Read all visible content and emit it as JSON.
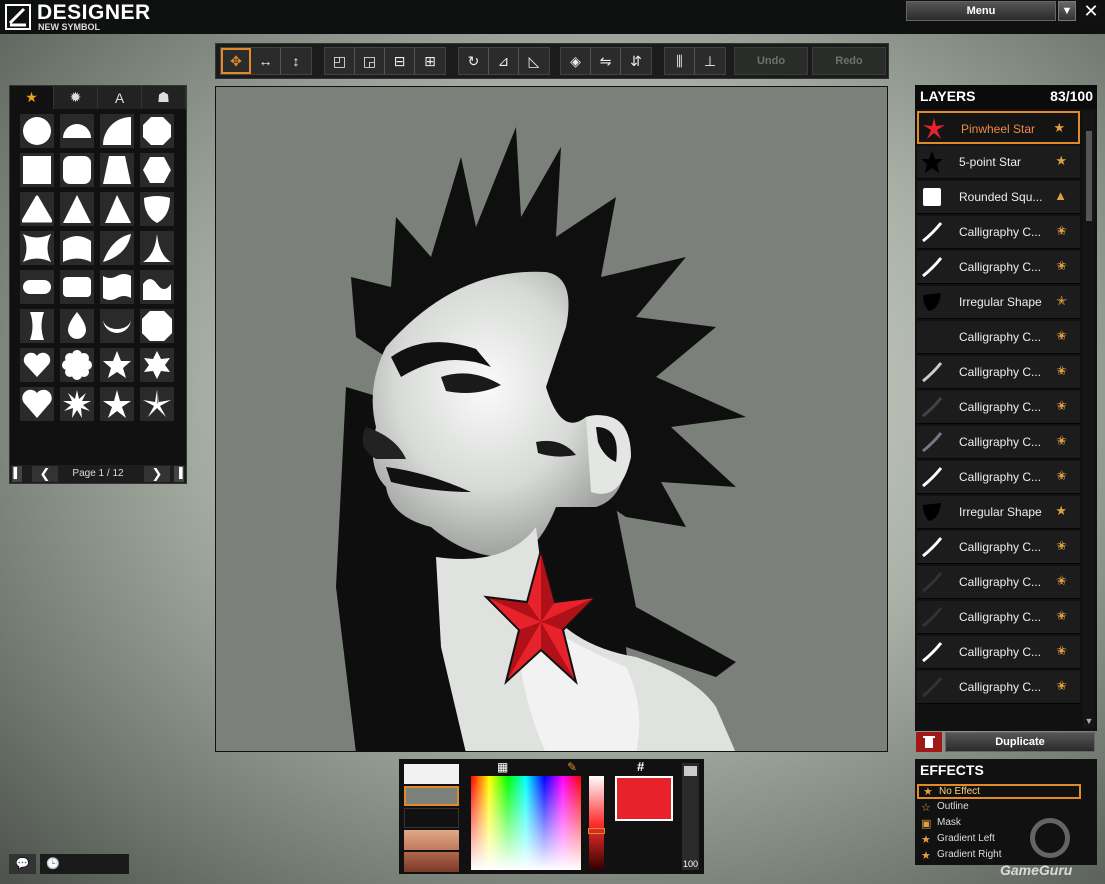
{
  "app": {
    "title": "DESIGNER",
    "subtitle": "NEW SYMBOL"
  },
  "topbar": {
    "menu_label": "Menu"
  },
  "toolbar": {
    "undo_label": "Undo",
    "redo_label": "Redo"
  },
  "shapes": {
    "tabs": [
      {
        "icon": "star-icon"
      },
      {
        "icon": "splat-icon"
      },
      {
        "icon": "text-icon",
        "label": "A"
      },
      {
        "icon": "stencil-icon"
      }
    ],
    "page_label": "Page 1 / 12"
  },
  "layers": {
    "title": "LAYERS",
    "count": "83/100",
    "items": [
      {
        "name": "Pinwheel Star",
        "thumb": "pinwheel-star"
      },
      {
        "name": "5-point Star",
        "thumb": "star"
      },
      {
        "name": "Rounded Squ...",
        "thumb": "square"
      },
      {
        "name": "Calligraphy C...",
        "thumb": "calligraphy"
      },
      {
        "name": "Calligraphy C...",
        "thumb": "calligraphy"
      },
      {
        "name": "Irregular Shape",
        "thumb": "irregular"
      },
      {
        "name": "Calligraphy C...",
        "thumb": "none"
      },
      {
        "name": "Calligraphy C...",
        "thumb": "calligraphy"
      },
      {
        "name": "Calligraphy C...",
        "thumb": "calligraphy"
      },
      {
        "name": "Calligraphy C...",
        "thumb": "calligraphy"
      },
      {
        "name": "Calligraphy C...",
        "thumb": "calligraphy"
      },
      {
        "name": "Irregular Shape",
        "thumb": "irregular"
      },
      {
        "name": "Calligraphy C...",
        "thumb": "calligraphy"
      },
      {
        "name": "Calligraphy C...",
        "thumb": "calligraphy"
      },
      {
        "name": "Calligraphy C...",
        "thumb": "calligraphy"
      },
      {
        "name": "Calligraphy C...",
        "thumb": "calligraphy"
      },
      {
        "name": "Calligraphy C...",
        "thumb": "calligraphy"
      }
    ],
    "duplicate_label": "Duplicate"
  },
  "effects": {
    "title": "EFFECTS",
    "items": [
      "No Effect",
      "Outline",
      "Mask",
      "Gradient Left",
      "Gradient Right"
    ]
  },
  "color": {
    "current_hex": "#e8222b",
    "opacity": "100",
    "swatches": [
      "#f2f2f2",
      "#7b817a",
      "#111111",
      "#d99a7a",
      "#b0664a"
    ]
  },
  "watermark": "GameGuru",
  "colors": {
    "accent": "#e08a2a",
    "star_red": "#e8222b"
  }
}
